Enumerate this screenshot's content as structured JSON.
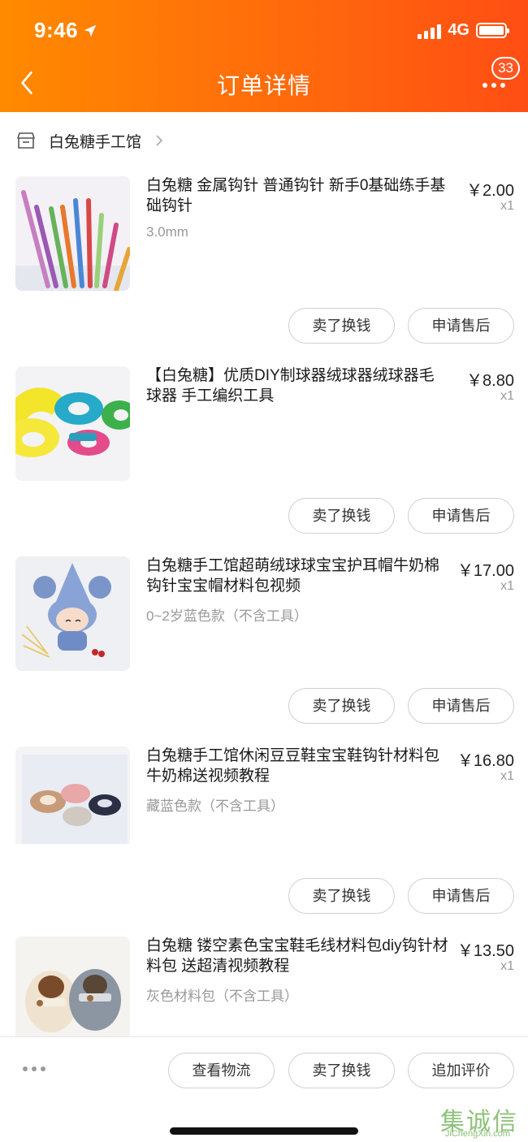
{
  "status_bar": {
    "time": "9:46",
    "network": "4G"
  },
  "header": {
    "title": "订单详情",
    "badge_count": "33"
  },
  "shop": {
    "name": "白兔糖手工馆"
  },
  "items": [
    {
      "name": "白兔糖 金属钩针 普通钩针 新手0基础练手基础钩针",
      "spec": "3.0mm",
      "price": "￥2.00",
      "qty": "x1",
      "sell_label": "卖了换钱",
      "after_sale_label": "申请售后",
      "image": "crochet-hooks"
    },
    {
      "name": "【白兔糖】优质DIY制球器绒球器绒球器毛球器 手工编织工具",
      "spec": "",
      "price": "￥8.80",
      "qty": "x1",
      "sell_label": "卖了换钱",
      "after_sale_label": "申请售后",
      "image": "pompom-makers"
    },
    {
      "name": "白兔糖手工馆超萌绒球球宝宝护耳帽牛奶棉钩针宝宝帽材料包视频",
      "spec": "0~2岁蓝色款（不含工具）",
      "price": "￥17.00",
      "qty": "x1",
      "sell_label": "卖了换钱",
      "after_sale_label": "申请售后",
      "image": "baby-hat-doll"
    },
    {
      "name": "白兔糖手工馆休闲豆豆鞋宝宝鞋钩针材料包牛奶棉送视频教程",
      "spec": "藏蓝色款（不含工具）",
      "price": "￥16.80",
      "qty": "x1",
      "sell_label": "卖了换钱",
      "after_sale_label": "申请售后",
      "image": "baby-loafers"
    },
    {
      "name": "白兔糖 镂空素色宝宝鞋毛线材料包diy钩针材料包 送超清视频教程",
      "spec": "灰色材料包（不含工具）",
      "price": "￥13.50",
      "qty": "x1",
      "image": "baby-shoes-grey"
    }
  ],
  "bottom_bar": {
    "logistics_label": "查看物流",
    "sell_label": "卖了换钱",
    "review_label": "追加评价"
  },
  "watermark": {
    "main": "集诚信",
    "sub": "JiChengXin.com"
  },
  "colors": {
    "header_start": "#ff8a00",
    "header_end": "#ff4e14"
  }
}
